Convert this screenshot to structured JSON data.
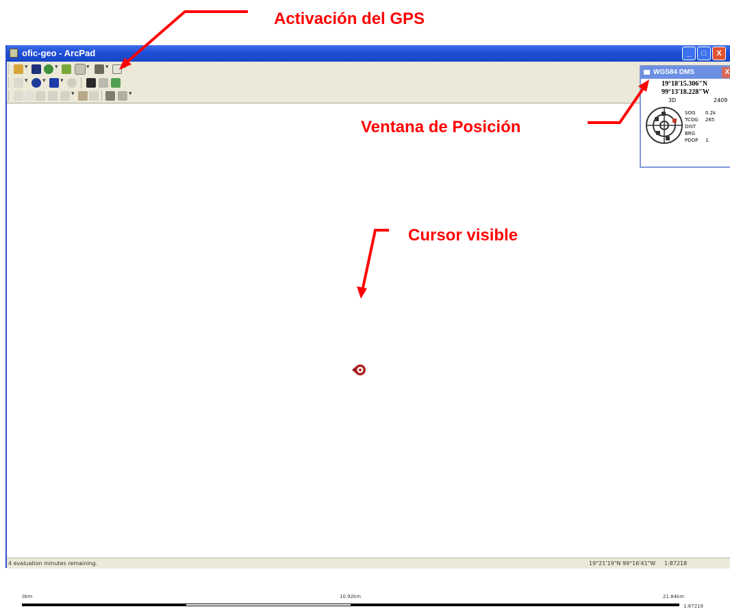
{
  "annotations": {
    "gps_activation": "Activación del GPS",
    "position_window": "Ventana de Posición",
    "cursor_visible": "Cursor visible"
  },
  "window": {
    "title": "ofic-geo - ArcPad",
    "minimize": "_",
    "maximize": "□",
    "close": "X"
  },
  "position_window": {
    "title": "WGS84 DMS",
    "close": "X",
    "latitude": "19°18'15.306\"N",
    "longitude": "99°13'18.228\"W",
    "fix": "3D",
    "altitude": "2409",
    "stats": [
      {
        "label": "SOG",
        "value": "0.2k"
      },
      {
        "label": "TCOG",
        "value": "265"
      },
      {
        "label": "DIST",
        "value": ""
      },
      {
        "label": "BRG",
        "value": ""
      },
      {
        "label": "PDOP",
        "value": "1."
      }
    ]
  },
  "scalebar": {
    "left": "0km",
    "middle": "10.92km",
    "right": "21.84km",
    "ratio": "1:87218"
  },
  "statusbar": {
    "message": "4 evaluation minutes remaining.",
    "coords": "19°21'19\"N 99°16'41\"W",
    "scale": "1:87218"
  },
  "colors": {
    "annotation": "#ff0000",
    "titlebar": "#1f4fd8",
    "toolbar": "#ece9d8"
  }
}
